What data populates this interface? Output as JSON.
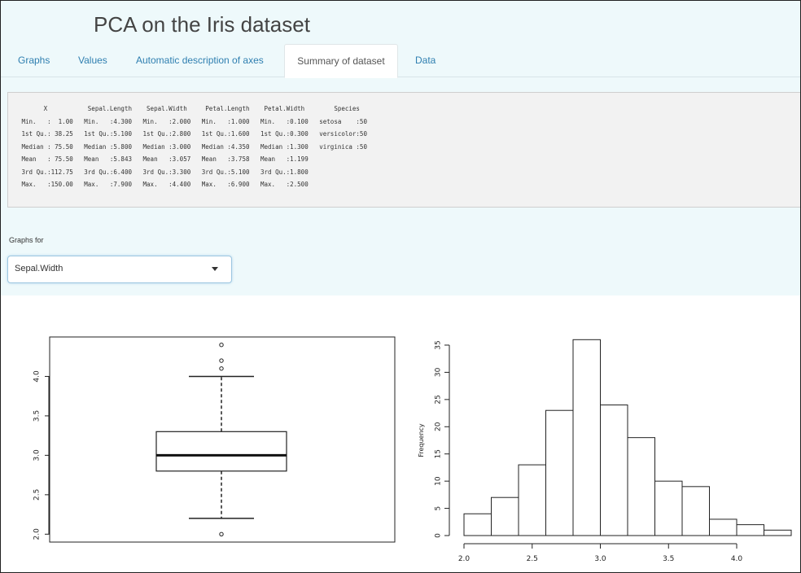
{
  "app": {
    "title": "PCA on the Iris dataset"
  },
  "tabs": [
    {
      "label": "Graphs",
      "active": false
    },
    {
      "label": "Values",
      "active": false
    },
    {
      "label": "Automatic description of axes",
      "active": false
    },
    {
      "label": "Summary of dataset",
      "active": true
    },
    {
      "label": "Data",
      "active": false
    }
  ],
  "summary": {
    "lines": [
      "       X           Sepal.Length    Sepal.Width     Petal.Length    Petal.Width        Species  ",
      " Min.   :  1.00   Min.   :4.300   Min.   :2.000   Min.   :1.000   Min.   :0.100   setosa    :50  ",
      " 1st Qu.: 38.25   1st Qu.:5.100   1st Qu.:2.800   1st Qu.:1.600   1st Qu.:0.300   versicolor:50  ",
      " Median : 75.50   Median :5.800   Median :3.000   Median :4.350   Median :1.300   virginica :50  ",
      " Mean   : 75.50   Mean   :5.843   Mean   :3.057   Mean   :3.758   Mean   :1.199                  ",
      " 3rd Qu.:112.75   3rd Qu.:6.400   3rd Qu.:3.300   3rd Qu.:5.100   3rd Qu.:1.800                  ",
      " Max.   :150.00   Max.   :7.900   Max.   :4.400   Max.   :6.900   Max.   :2.500                  "
    ]
  },
  "controls": {
    "graphs_for_label": "Graphs for",
    "selected_variable": "Sepal.Width"
  },
  "colors": {
    "panel_bg": "#eef9fb",
    "tab_link": "#2f7fb0",
    "select_border": "#9cc6e0"
  },
  "chart_data": [
    {
      "type": "box",
      "ylim": [
        1.9,
        4.5
      ],
      "yticks": [
        "2.0",
        "2.5",
        "3.0",
        "3.5",
        "4.0"
      ],
      "ytick_values": [
        2.0,
        2.5,
        3.0,
        3.5,
        4.0
      ],
      "box": {
        "q1": 2.8,
        "median": 3.0,
        "q3": 3.3,
        "whisker_low": 2.2,
        "whisker_high": 4.0
      },
      "outliers": [
        2.0,
        4.1,
        4.2,
        4.4
      ]
    },
    {
      "type": "bar",
      "ylabel": "Frequency",
      "bin_edges": [
        2.0,
        2.2,
        2.4,
        2.6,
        2.8,
        3.0,
        3.2,
        3.4,
        3.6,
        3.8,
        4.0,
        4.2,
        4.4
      ],
      "values": [
        4,
        7,
        13,
        23,
        36,
        24,
        18,
        10,
        9,
        3,
        2,
        1
      ],
      "xticks": [
        "2.0",
        "2.5",
        "3.0",
        "3.5",
        "4.0"
      ],
      "xtick_values": [
        2.0,
        2.5,
        3.0,
        3.5,
        4.0
      ],
      "yticks": [
        "0",
        "5",
        "10",
        "15",
        "20",
        "25",
        "30",
        "35"
      ],
      "ytick_values": [
        0,
        5,
        10,
        15,
        20,
        25,
        30,
        35
      ],
      "ylim": [
        0,
        37
      ]
    }
  ]
}
